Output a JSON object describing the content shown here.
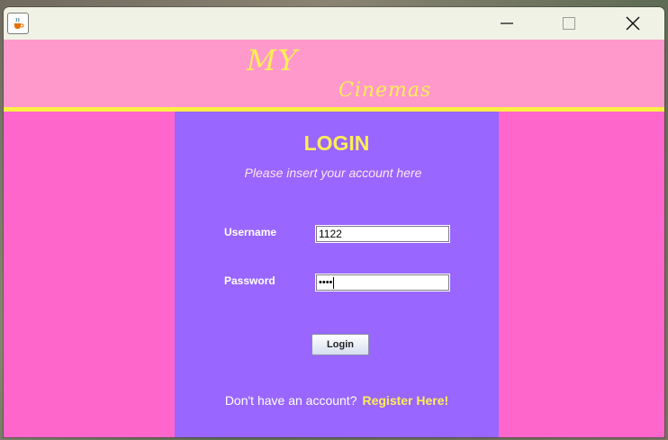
{
  "window": {
    "icon": "java-cup-icon",
    "controls": [
      "minimize-icon",
      "maximize-icon",
      "close-icon"
    ]
  },
  "header": {
    "logo_line1": "MY",
    "logo_line2": "Cinemas"
  },
  "login": {
    "title": "LOGIN",
    "subtitle": "Please insert your account here",
    "username_label": "Username",
    "username_value": "1122",
    "password_label": "Password",
    "password_masked": "••••",
    "button_label": "Login",
    "no_account_text": "Don't have an account?",
    "register_link": "Register Here!"
  },
  "colors": {
    "background_pink": "#ff66cc",
    "header_pink": "#ff99cc",
    "accent_yellow": "#ffee55",
    "panel_purple": "#9966ff"
  }
}
